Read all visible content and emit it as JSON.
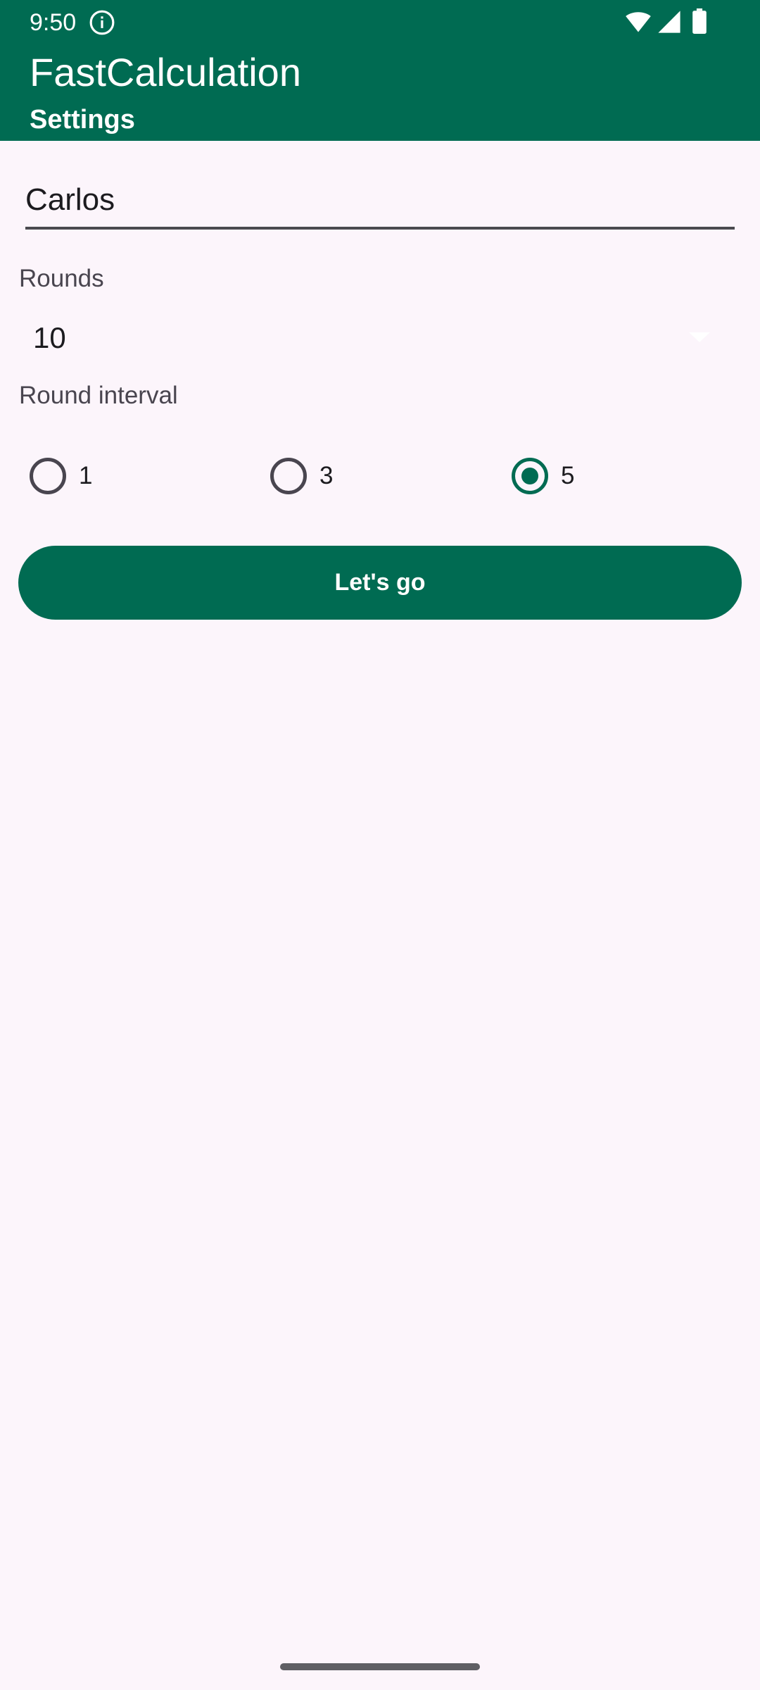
{
  "status_bar": {
    "time": "9:50",
    "icons": [
      "info-icon",
      "wifi-icon",
      "signal-icon",
      "battery-icon"
    ]
  },
  "header": {
    "title": "FastCalculation",
    "subtitle": "Settings"
  },
  "form": {
    "name_value": "Carlos",
    "rounds_label": "Rounds",
    "rounds_value": "10",
    "interval_label": "Round interval",
    "interval_options": [
      "1",
      "3",
      "5"
    ],
    "interval_selected": "5",
    "submit_label": "Let's go"
  },
  "colors": {
    "primary": "#006b52",
    "background": "#fcf5fb",
    "on_surface": "#1c1b1f",
    "label": "#49454f"
  }
}
